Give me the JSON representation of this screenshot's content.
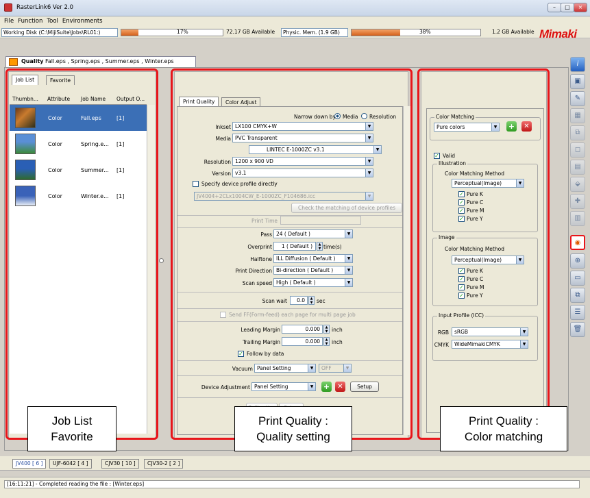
{
  "window": {
    "title": "RasterLink6 Ver 2.0",
    "minimize": "–",
    "maximize": "□",
    "close": "×"
  },
  "menu": [
    "File",
    "Function",
    "Tool",
    "Environments"
  ],
  "disk": {
    "working_label": "Working Disk (C:\\MijiSuite\\Jobs\\RL01:)",
    "working_percent": "17%",
    "working_fill": 0.17,
    "working_available": "72.17 GB Available",
    "physic_label": "Physic. Mem. (1.9 GB)",
    "physic_percent": "38%",
    "physic_fill": 0.38,
    "physic_available": "1.2 GB Available",
    "brand": "Mimaki"
  },
  "doc_tab": {
    "label": "Quality",
    "files": "Fall.eps , Spring.eps , Summer.eps , Winter.eps"
  },
  "joblist": {
    "tabs": [
      "Job List",
      "Favorite"
    ],
    "columns": [
      "Thumbn...",
      "Attribute",
      "Job Name",
      "Output O..."
    ],
    "rows": [
      {
        "attribute": "Color",
        "name": "Fall.eps",
        "output": "[1]"
      },
      {
        "attribute": "Color",
        "name": "Spring.e...",
        "output": "[1]"
      },
      {
        "attribute": "Color",
        "name": "Summer...",
        "output": "[1]"
      },
      {
        "attribute": "Color",
        "name": "Winter.e...",
        "output": "[1]"
      }
    ]
  },
  "quality": {
    "tabs": [
      "Print Quality",
      "Color Adjust"
    ],
    "narrow_label": "Narrow down by",
    "narrow_media": "Media",
    "narrow_resolution": "Resolution",
    "inkset_label": "Inkset",
    "inkset": "LX100 CMYK+W",
    "media_label": "Media",
    "media": "PVC Transparent",
    "media_sub": "LINTEC E-1000ZC v3.1",
    "resolution_label": "Resolution",
    "resolution": "1200 x 900 VD",
    "version_label": "Version",
    "version": "v3.1",
    "specify_label": "Specify device profile directly",
    "profile": "JV4004+2CLx1004CW_E-1000ZC_F104686.icc",
    "check_btn": "Check the matching of device profiles",
    "print_time_label": "Print Time",
    "pass_label": "Pass",
    "pass": "24 ( Default )",
    "overprint_label": "Overprint",
    "overprint": "1 ( Default )",
    "overprint_unit": "time(s)",
    "halftone_label": "Halftone",
    "halftone": "ILL Diffusion ( Default )",
    "direction_label": "Print Direction",
    "direction": "Bi-direction ( Default )",
    "scan_label": "Scan speed",
    "scan": "High ( Default )",
    "scanwait_label": "Scan wait",
    "scanwait": "0.0",
    "scanwait_unit": "sec",
    "feed_label": "Send FF(Form-feed) each page for multi page job",
    "leading_label": "Leading Margin",
    "leading": "0.000",
    "trailing_label": "Trailing Margin",
    "trailing": "0.000",
    "margin_unit": "inch",
    "follow_label": "Follow by data",
    "vacuum_label": "Vacuum",
    "vacuum": "Panel Setting",
    "vacuum_off": "OFF",
    "device_label": "Device Adjustment",
    "device": "Panel Setting",
    "setup": "Setup",
    "calibration": "Calibration",
    "setup2": "Setup"
  },
  "color": {
    "matching_title": "Color Matching",
    "matching": "Pure colors",
    "valid": "Valid",
    "illustration_title": "Illustration",
    "method_label": "Color Matching Method",
    "ill_method": "Perceptual(Image)",
    "ill_checks": [
      "Pure K",
      "Pure C",
      "Pure M",
      "Pure Y"
    ],
    "image_title": "Image",
    "img_method": "Perceptual(Image)",
    "img_checks": [
      "Pure K",
      "Pure C",
      "Pure M",
      "Pure Y"
    ],
    "input_title": "Input Profile (ICC)",
    "rgb_label": "RGB",
    "rgb": "sRGB",
    "cmyk_label": "CMYK",
    "cmyk": "WideMimakiCMYK"
  },
  "captions": {
    "joblist": [
      "Job List",
      "Favorite"
    ],
    "quality": [
      "Print Quality :",
      "Quality setting"
    ],
    "color": [
      "Print Quality :",
      "Color matching"
    ]
  },
  "printers": [
    "JV400 [ 6 ]",
    "UJF-6042 [ 4 ]",
    "CJV30 [ 10 ]",
    "CJV30-2 [ 2 ]"
  ],
  "status": "[16:11:21] - Completed reading the file : [Winter.eps]"
}
